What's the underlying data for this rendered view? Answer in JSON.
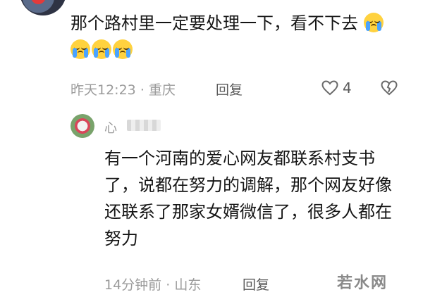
{
  "comment1": {
    "username": "",
    "text": "那个路村里一定要处理一下，看不下去",
    "emoji_count": 4,
    "time": "昨天12:23",
    "location": "重庆",
    "separator": "·",
    "reply_label": "回复",
    "like_count": "4"
  },
  "reply1": {
    "username": "心",
    "text": "有一个河南的爱心网友都联系村支书了，说都在努力的调解，那个网友好像还联系了那家女婿微信了，很多人都在努力",
    "time": "14分钟前",
    "location": "山东",
    "separator": "·",
    "reply_label": "回复"
  },
  "watermark": "若水网",
  "icons": {
    "like": "heart-outline-icon",
    "dislike": "broken-heart-icon",
    "emoji": "crying-face-emoji"
  },
  "colors": {
    "text": "#151515",
    "meta": "#9b9b9b",
    "icon": "#6a6a6a"
  }
}
